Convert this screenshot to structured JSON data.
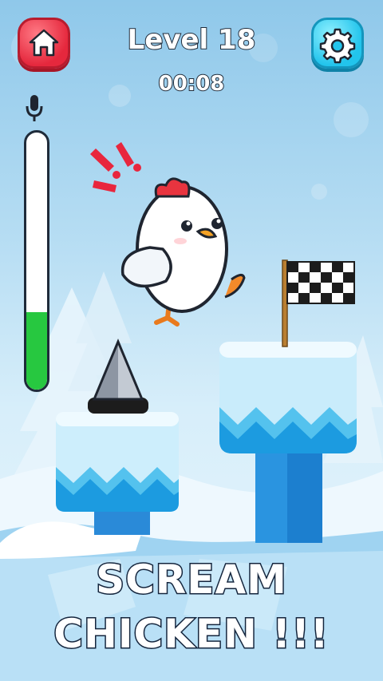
{
  "hud": {
    "level_title": "Level 18",
    "timer": "00:08",
    "home_icon": "home-icon",
    "settings_icon": "gear-icon",
    "mic_icon": "microphone-icon"
  },
  "voice_meter": {
    "level_fraction": 0.3
  },
  "game_title": {
    "line1": "SCREAM",
    "line2": "CHICKEN !!!"
  },
  "colors": {
    "home_button": "#e5283d",
    "settings_button": "#22c4ec",
    "meter_fill": "#27c840",
    "chicken_comb": "#e8343f",
    "alert_marks": "#e8263d"
  }
}
